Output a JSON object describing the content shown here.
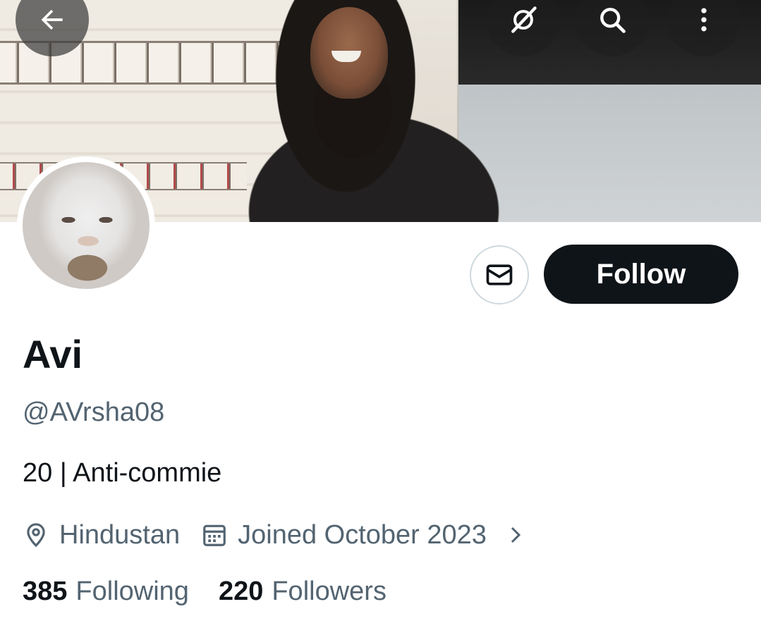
{
  "header": {
    "back_icon": "arrow-left-icon",
    "grok_icon": "grok-icon",
    "search_icon": "search-icon",
    "more_icon": "more-vertical-icon"
  },
  "profile": {
    "name": "Avi",
    "handle": "@AVrsha08",
    "bio": "20 | Anti-commie",
    "location": "Hindustan",
    "joined": "Joined October 2023",
    "following_count": "385",
    "following_label": "Following",
    "followers_count": "220",
    "followers_label": "Followers"
  },
  "actions": {
    "message_icon": "envelope-icon",
    "follow_label": "Follow"
  },
  "colors": {
    "text_primary": "#0f1419",
    "text_secondary": "#536471",
    "follow_bg": "#0f1419",
    "border": "#cfd9de"
  }
}
